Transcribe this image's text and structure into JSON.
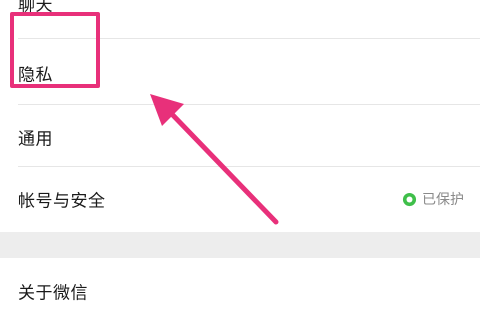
{
  "settings": {
    "top_item_label": "聊天",
    "privacy_label": "隐私",
    "general_label": "通用",
    "account_security_label": "帐号与安全",
    "account_security_status": "已保护",
    "about_label": "关于微信"
  },
  "colors": {
    "highlight": "#e8307a",
    "status_icon": "#3fbf4a",
    "section_gap": "#ededed"
  },
  "icons": {
    "status": "check-circle-icon",
    "annotation_arrow": "arrow-icon"
  }
}
